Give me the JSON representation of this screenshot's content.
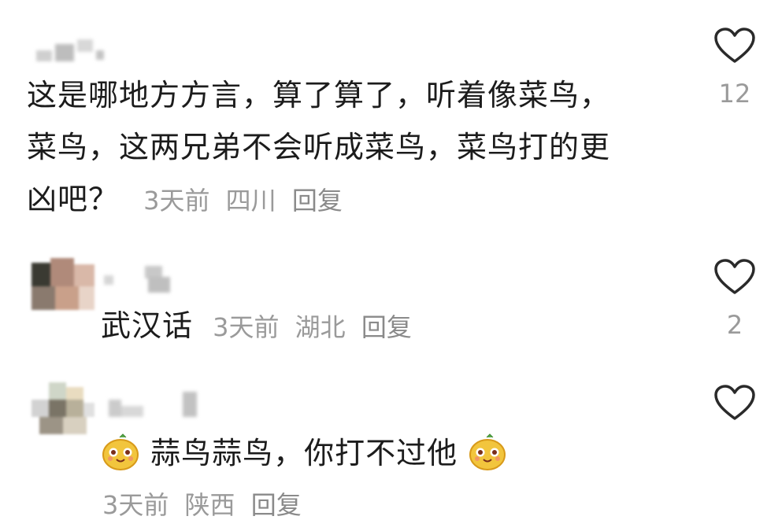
{
  "comments": [
    {
      "text_line1": "这是哪地方方言，算了算了，听着像菜鸟，",
      "text_line2": "菜鸟，这两兄弟不会听成菜鸟，菜鸟打的更",
      "text_line3": "凶吧？",
      "time": "3天前",
      "location": "四川",
      "reply": "回复",
      "likes": "12"
    },
    {
      "text": "武汉话",
      "time": "3天前",
      "location": "湖北",
      "reply": "回复",
      "likes": "2"
    },
    {
      "text": "蒜鸟蒜鸟，你打不过他",
      "time": "3天前",
      "location": "陕西",
      "reply": "回复",
      "likes": ""
    }
  ],
  "icons": {
    "like": "heart-outline-icon",
    "emoji": "yellow-face-emoji"
  },
  "colors": {
    "text": "#1c1c1c",
    "meta": "#9a9a9a",
    "icon": "#2a2a2a"
  }
}
